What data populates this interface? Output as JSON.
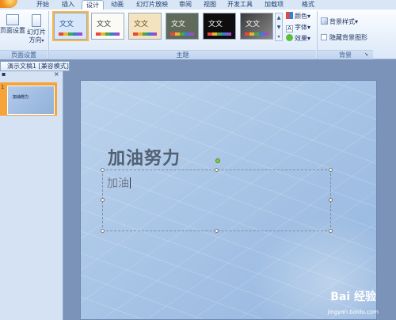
{
  "tabs": [
    "开始",
    "插入",
    "设计",
    "动画",
    "幻灯片放映",
    "审阅",
    "视图",
    "开发工具",
    "加载项",
    "格式"
  ],
  "active_tab": "设计",
  "page_setup": {
    "page_setup_label": "页面设置",
    "orientation_label_line1": "幻灯片",
    "orientation_label_line2": "方向",
    "group_label": "页面设置"
  },
  "themes": {
    "group_label": "主题",
    "thumb_text": "文文"
  },
  "theme_options": {
    "colors": "颜色",
    "fonts": "字体",
    "effects": "效果"
  },
  "background": {
    "styles": "背景样式",
    "hide_graphics": "隐藏背景图形",
    "group_label": "背景"
  },
  "document": {
    "tab_title": "演示文稿1 [兼容模式]"
  },
  "slides_panel": {
    "slide_number": "1"
  },
  "slide": {
    "title": "加油努力",
    "body_text": "加油"
  },
  "watermark": {
    "brand": "Bai 经验",
    "url": "jingyan.baidu.com"
  },
  "colors": {
    "accent": "#f6a33a",
    "ribbon_bg": "#dbe8f8"
  }
}
